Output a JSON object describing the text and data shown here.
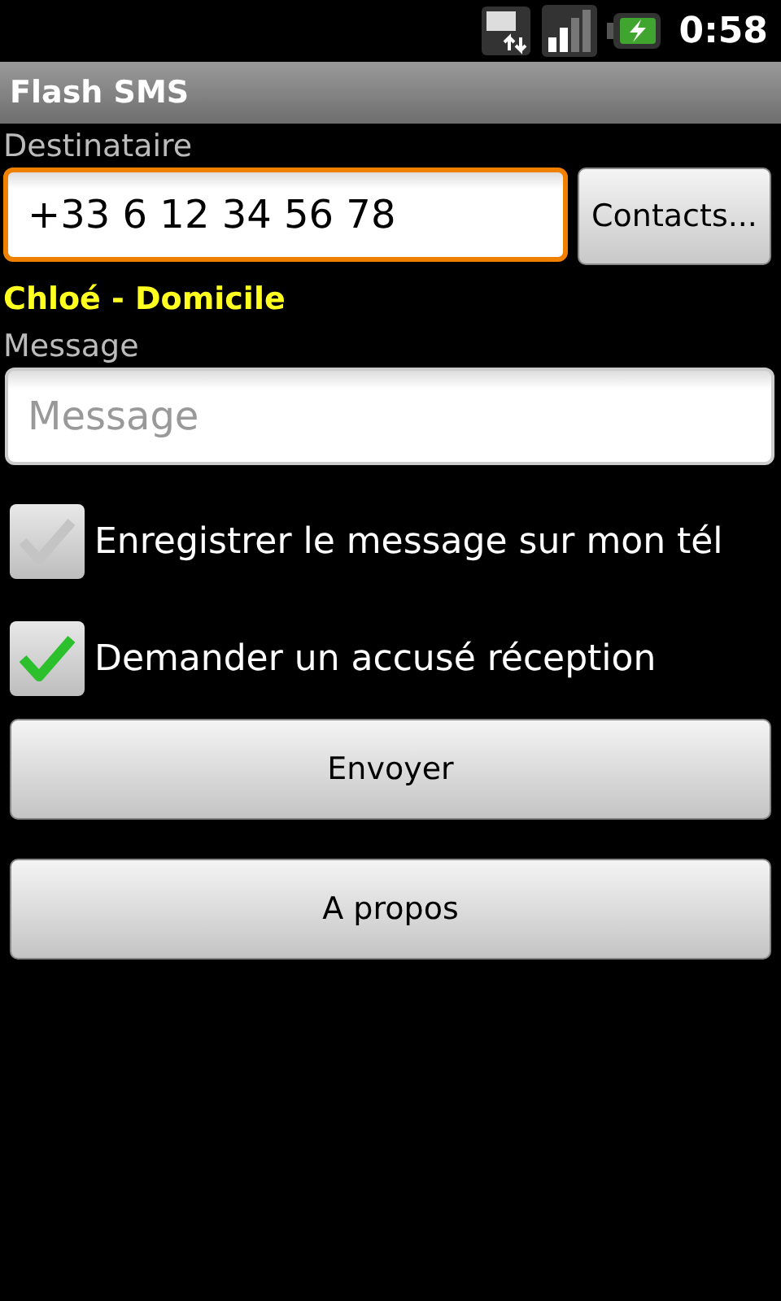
{
  "status_bar": {
    "time": "0:58"
  },
  "window": {
    "title": "Flash SMS"
  },
  "recipient": {
    "label": "Destinataire",
    "value": "+33 6 12 34 56 78",
    "focused": true,
    "contacts_button": "Contacts..."
  },
  "contact_name": "Chloé - Domicile",
  "message": {
    "label": "Message",
    "placeholder": "Message"
  },
  "options": [
    {
      "label": "Enregistrer le message sur mon tél",
      "checked": false
    },
    {
      "label": "Demander un accusé réception",
      "checked": true
    }
  ],
  "buttons": [
    "Envoyer",
    "A propos"
  ]
}
